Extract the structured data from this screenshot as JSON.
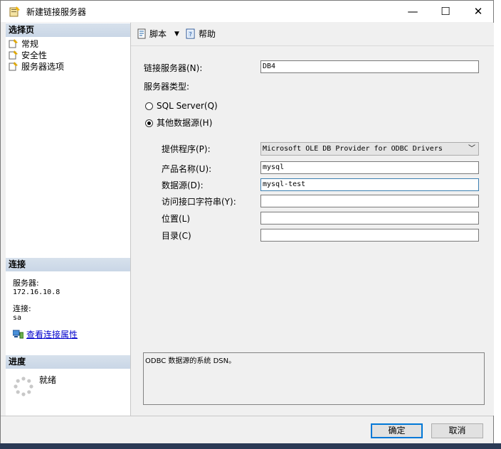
{
  "window": {
    "title": "新建链接服务器"
  },
  "titlebar": {
    "minimize": "—",
    "maximize": "☐",
    "close": "✕"
  },
  "sidebar": {
    "pages_header": "选择页",
    "pages": [
      {
        "label": "常规"
      },
      {
        "label": "安全性"
      },
      {
        "label": "服务器选项"
      }
    ],
    "connection_header": "连接",
    "server_label": "服务器:",
    "server_value": "172.16.10.8",
    "connection_label": "连接:",
    "connection_value": "sa",
    "view_props_link": "查看连接属性",
    "progress_header": "进度",
    "progress_status": "就绪"
  },
  "toolbar": {
    "script_label": "脚本",
    "help_label": "帮助"
  },
  "form": {
    "linked_server_label": "链接服务器(N):",
    "linked_server_value": "DB4",
    "server_type_label": "服务器类型:",
    "radio_sql_server": "SQL Server(Q)",
    "radio_other": "其他数据源(H)",
    "provider_label": "提供程序(P):",
    "provider_value": "Microsoft OLE DB Provider for ODBC Drivers",
    "product_name_label": "产品名称(U):",
    "product_name_value": "mysql",
    "data_source_label": "数据源(D):",
    "data_source_value": "mysql-test",
    "provider_string_label": "访问接口字符串(Y):",
    "provider_string_value": "",
    "location_label": "位置(L)",
    "location_value": "",
    "catalog_label": "目录(C)",
    "catalog_value": "",
    "description": "ODBC 数据源的系统 DSN。"
  },
  "footer": {
    "ok_label": "确定",
    "cancel_label": "取消"
  },
  "colors": {
    "accent": "#0078d7",
    "section_header": "#d7e1ec",
    "link": "#0000cc"
  }
}
